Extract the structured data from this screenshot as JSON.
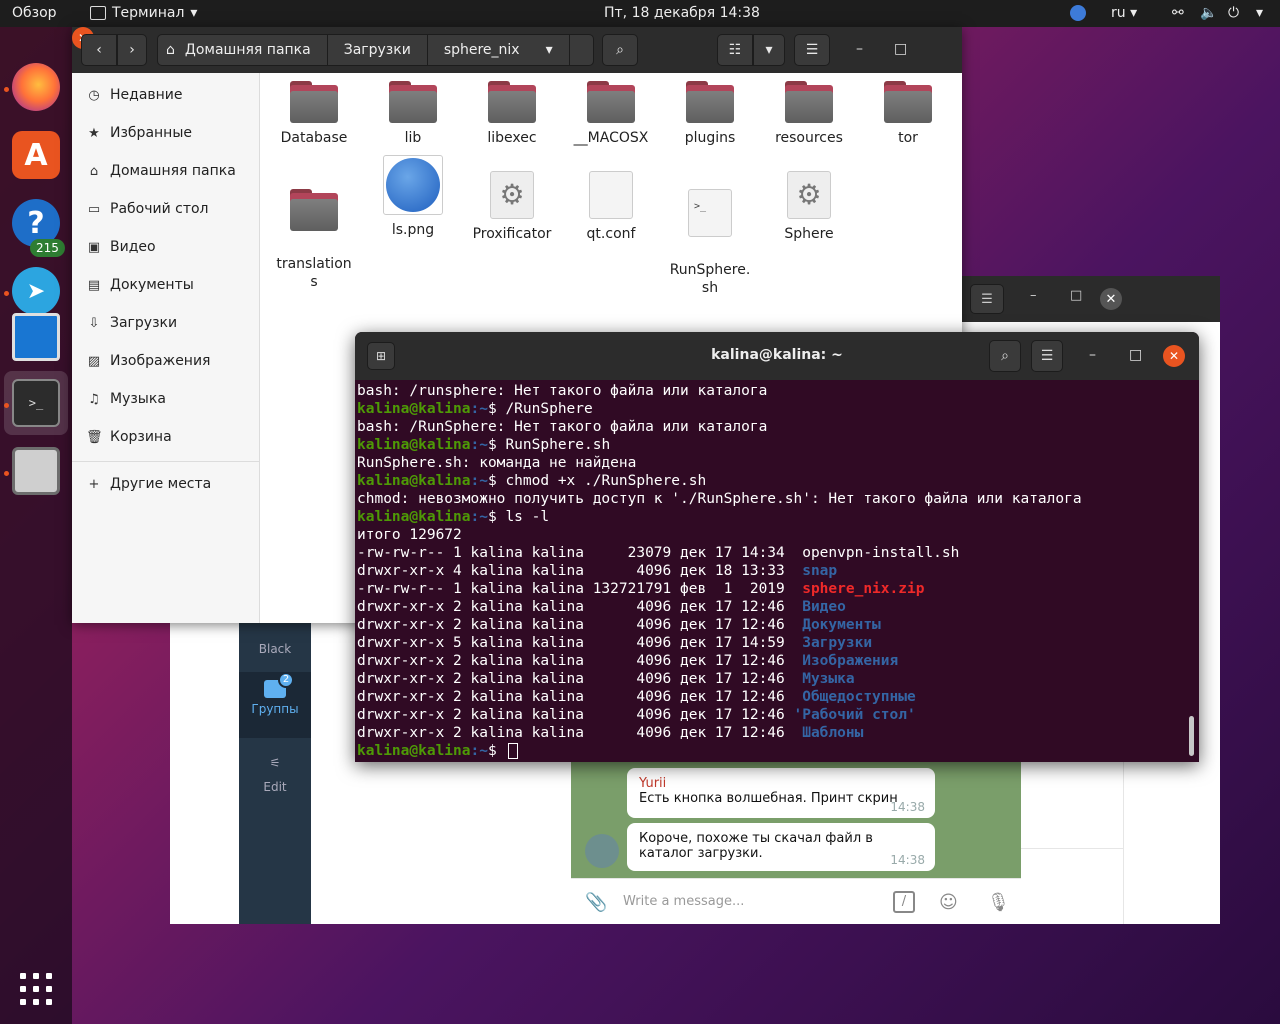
{
  "topbar": {
    "activities": "Обзор",
    "app_menu": "Терминал",
    "clock": "Пт, 18 декабря  14:38",
    "lang": "ru"
  },
  "dock": {
    "telegram_badge": "215"
  },
  "files": {
    "breadcrumb": [
      "Домашняя папка",
      "Загрузки",
      "sphere_nix"
    ],
    "sidebar": [
      {
        "label": "Недавние",
        "icon": "clock-icon"
      },
      {
        "label": "Избранные",
        "icon": "star-icon"
      },
      {
        "label": "Домашняя папка",
        "icon": "home-icon"
      },
      {
        "label": "Рабочий стол",
        "icon": "desktop-icon"
      },
      {
        "label": "Видео",
        "icon": "video-icon"
      },
      {
        "label": "Документы",
        "icon": "document-icon"
      },
      {
        "label": "Загрузки",
        "icon": "download-icon"
      },
      {
        "label": "Изображения",
        "icon": "image-icon"
      },
      {
        "label": "Музыка",
        "icon": "music-icon"
      },
      {
        "label": "Корзина",
        "icon": "trash-icon"
      }
    ],
    "other_places": "Другие места",
    "items": [
      {
        "name": "Database",
        "kind": "folder"
      },
      {
        "name": "lib",
        "kind": "folder"
      },
      {
        "name": "libexec",
        "kind": "folder"
      },
      {
        "name": "__MACOSX",
        "kind": "folder"
      },
      {
        "name": "plugins",
        "kind": "folder"
      },
      {
        "name": "resources",
        "kind": "folder"
      },
      {
        "name": "tor",
        "kind": "folder"
      },
      {
        "name": "translation\ns",
        "kind": "folder"
      },
      {
        "name": "ls.png",
        "kind": "image"
      },
      {
        "name": "Proxificator",
        "kind": "executable"
      },
      {
        "name": "qt.conf",
        "kind": "text"
      },
      {
        "name": "RunSphere.\nsh",
        "kind": "script"
      },
      {
        "name": "Sphere",
        "kind": "executable"
      }
    ]
  },
  "telegram": {
    "side_black": "Black",
    "side_groups": "Группы",
    "side_groups_badge": "2",
    "side_edit": "Edit",
    "msg1_sender": "Yurii",
    "msg1_text": "Есть кнопка волшебная. Принт скрин",
    "msg1_time": "14:38",
    "msg2_text": "Короче, похоже ты скачал файл в каталог загрузки.",
    "msg2_time": "14:38",
    "input_placeholder": "Write a message..."
  },
  "terminal": {
    "title": "kalina@kalina: ~",
    "prompt_user": "kalina@kalina",
    "prompt_path": ":~",
    "prompt_sym": "$ ",
    "lines": [
      {
        "type": "out",
        "text": "bash: /runsphere: Нет такого файла или каталога"
      },
      {
        "type": "cmd",
        "text": "/RunSphere"
      },
      {
        "type": "out",
        "text": "bash: /RunSphere: Нет такого файла или каталога"
      },
      {
        "type": "cmd",
        "text": "RunSphere.sh"
      },
      {
        "type": "out",
        "text": "RunSphere.sh: команда не найдена"
      },
      {
        "type": "cmd",
        "text": "chmod +x ./RunSphere.sh"
      },
      {
        "type": "out",
        "text": "chmod: невозможно получить доступ к './RunSphere.sh': Нет такого файла или каталога"
      },
      {
        "type": "cmd",
        "text": "ls -l"
      },
      {
        "type": "out",
        "text": "итого 129672"
      },
      {
        "type": "ls",
        "meta": "-rw-rw-r-- 1 kalina kalina     23079 дек 17 14:34  ",
        "name": "openvpn-install.sh",
        "color": "file"
      },
      {
        "type": "ls",
        "meta": "drwxr-xr-x 4 kalina kalina      4096 дек 18 13:33  ",
        "name": "snap",
        "color": "dir"
      },
      {
        "type": "ls",
        "meta": "-rw-rw-r-- 1 kalina kalina 132721791 фев  1  2019  ",
        "name": "sphere_nix.zip",
        "color": "zip"
      },
      {
        "type": "ls",
        "meta": "drwxr-xr-x 2 kalina kalina      4096 дек 17 12:46  ",
        "name": "Видео",
        "color": "dir"
      },
      {
        "type": "ls",
        "meta": "drwxr-xr-x 2 kalina kalina      4096 дек 17 12:46  ",
        "name": "Документы",
        "color": "dir"
      },
      {
        "type": "ls",
        "meta": "drwxr-xr-x 5 kalina kalina      4096 дек 17 14:59  ",
        "name": "Загрузки",
        "color": "dir"
      },
      {
        "type": "ls",
        "meta": "drwxr-xr-x 2 kalina kalina      4096 дек 17 12:46  ",
        "name": "Изображения",
        "color": "dir"
      },
      {
        "type": "ls",
        "meta": "drwxr-xr-x 2 kalina kalina      4096 дек 17 12:46  ",
        "name": "Музыка",
        "color": "dir"
      },
      {
        "type": "ls",
        "meta": "drwxr-xr-x 2 kalina kalina      4096 дек 17 12:46  ",
        "name": "Общедоступные",
        "color": "dir"
      },
      {
        "type": "ls",
        "meta": "drwxr-xr-x 2 kalina kalina      4096 дек 17 12:46 ",
        "name": "'Рабочий стол'",
        "color": "dir"
      },
      {
        "type": "ls",
        "meta": "drwxr-xr-x 2 kalina kalina      4096 дек 17 12:46  ",
        "name": "Шаблоны",
        "color": "dir"
      },
      {
        "type": "prompt",
        "text": ""
      }
    ]
  }
}
